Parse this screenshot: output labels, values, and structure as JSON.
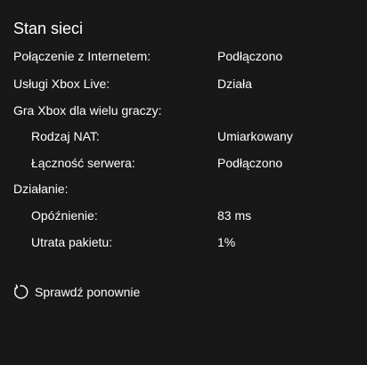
{
  "panel": {
    "title": "Stan sieci"
  },
  "rows": [
    {
      "label": "Połączenie z Internetem:",
      "value": "Podłączono"
    },
    {
      "label": "Usługi Xbox Live:",
      "value": "Działa"
    },
    {
      "label": "Gra Xbox dla wielu graczy:",
      "value": ""
    },
    {
      "label": "Rodzaj NAT:",
      "value": "Umiarkowany"
    },
    {
      "label": "Łączność serwera:",
      "value": "Podłączono"
    },
    {
      "label": "Działanie:",
      "value": ""
    },
    {
      "label": "Opóźnienie:",
      "value": "83 ms"
    },
    {
      "label": "Utrata pakietu:",
      "value": "1%"
    }
  ],
  "recheck": {
    "label": "Sprawdź ponownie",
    "icon": "refresh-icon"
  },
  "colors": {
    "background": "#181818",
    "text": "#ffffff"
  }
}
